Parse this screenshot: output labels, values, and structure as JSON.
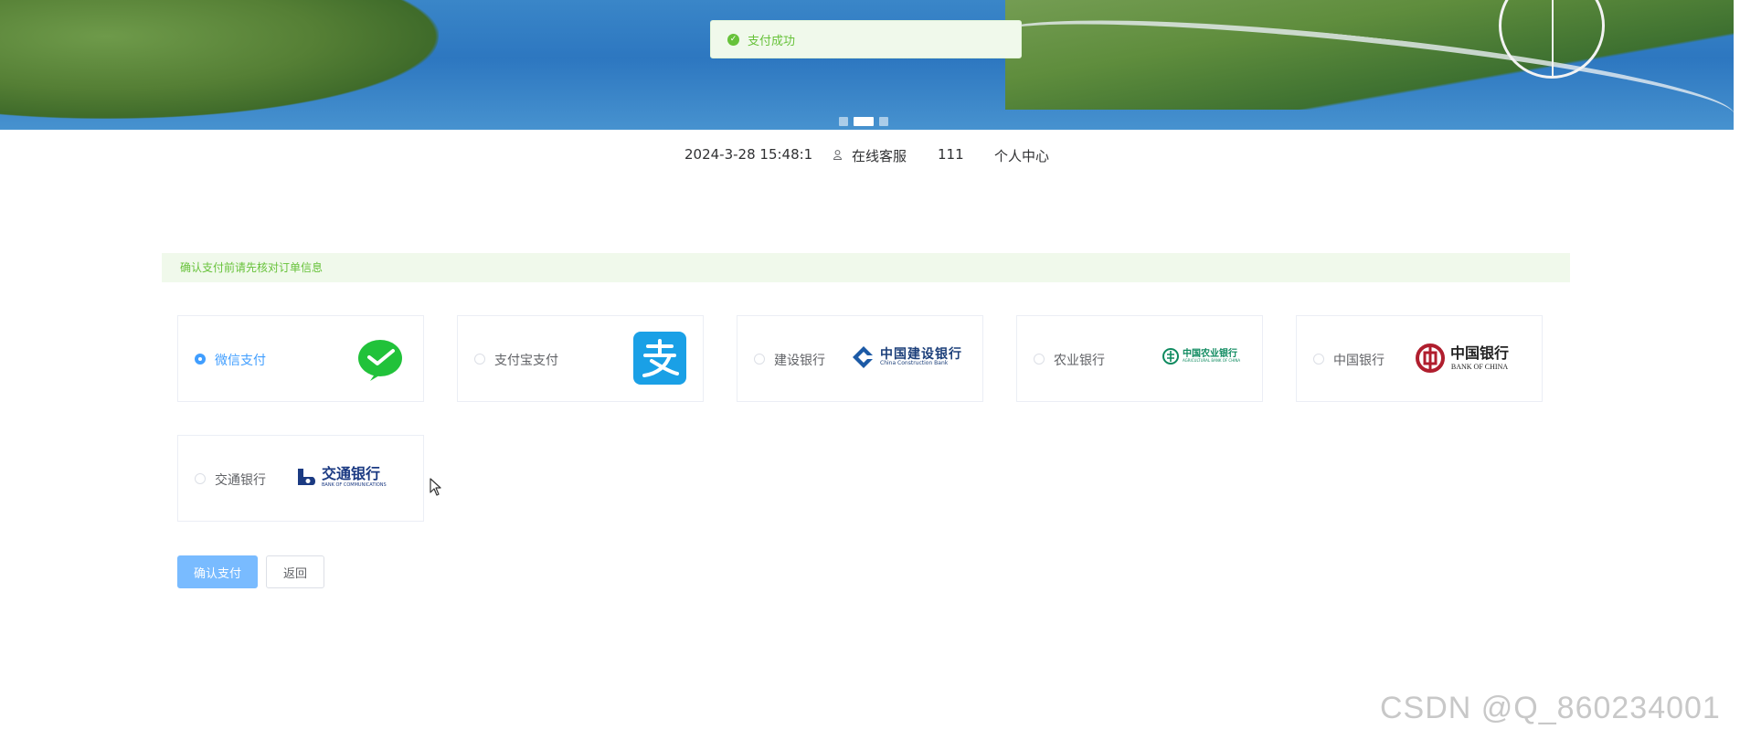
{
  "toast": {
    "message": "支付成功"
  },
  "topbar": {
    "datetime": "2024-3-28 15:48:1",
    "service": "在线客服",
    "username": "111",
    "profile": "个人中心"
  },
  "tip": "确认支付前请先核对订单信息",
  "payment_methods": [
    {
      "label": "微信支付",
      "selected": true,
      "icon": "wechat-pay-logo"
    },
    {
      "label": "支付宝支付",
      "selected": false,
      "icon": "alipay-logo"
    },
    {
      "label": "建设银行",
      "selected": false,
      "icon": "ccb-logo",
      "logo_text": "中国建设银行",
      "logo_sub": "China Construction Bank"
    },
    {
      "label": "农业银行",
      "selected": false,
      "icon": "abc-logo",
      "logo_text": "中国农业银行",
      "logo_sub": "AGRICULTURAL BANK OF CHINA"
    },
    {
      "label": "中国银行",
      "selected": false,
      "icon": "boc-logo",
      "logo_text": "中国银行",
      "logo_sub": "BANK OF CHINA"
    },
    {
      "label": "交通银行",
      "selected": false,
      "icon": "bocom-logo",
      "logo_text": "交通银行",
      "logo_sub": "BANK OF COMMUNICATIONS"
    }
  ],
  "buttons": {
    "confirm": "确认支付",
    "back": "返回"
  },
  "carousel": {
    "slides": 3,
    "active": 2
  },
  "watermark": "CSDN @Q_860234001",
  "colors": {
    "success": "#67c23a",
    "primary": "#409eff",
    "primary_light": "#79bbff"
  }
}
